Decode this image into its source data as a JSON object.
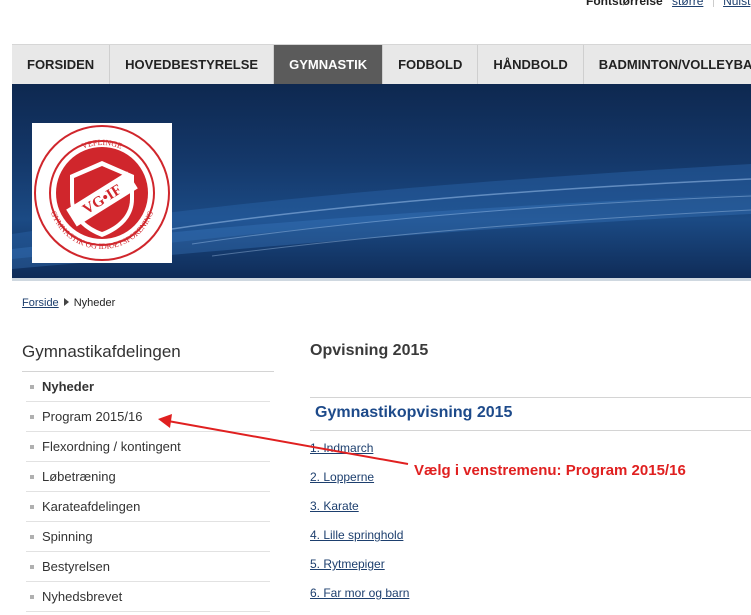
{
  "font_bar": {
    "label": "Fontstørrelse",
    "bigger": "større",
    "reset": "Nulst"
  },
  "nav": [
    {
      "label": "FORSIDEN",
      "active": false
    },
    {
      "label": "HOVEDBESTYRELSE",
      "active": false
    },
    {
      "label": "GYMNASTIK",
      "active": true
    },
    {
      "label": "FODBOLD",
      "active": false
    },
    {
      "label": "HÅNDBOLD",
      "active": false
    },
    {
      "label": "BADMINTON/VOLLEYBALL",
      "active": false
    }
  ],
  "logo": {
    "top_text": "VEFLINGE",
    "shield_text": "VG•IF",
    "bottom_text": "GYMNASTIK OG IDRÆTSFORENING"
  },
  "breadcrumb": {
    "home": "Forside",
    "current": "Nyheder"
  },
  "sidebar": {
    "title": "Gymnastikafdelingen",
    "items": [
      {
        "label": "Nyheder",
        "active": true
      },
      {
        "label": "Program 2015/16",
        "active": false
      },
      {
        "label": "Flexordning / kontingent",
        "active": false
      },
      {
        "label": "Løbetræning",
        "active": false
      },
      {
        "label": "Karateafdelingen",
        "active": false
      },
      {
        "label": "Spinning",
        "active": false
      },
      {
        "label": "Bestyrelsen",
        "active": false
      },
      {
        "label": "Nyhedsbrevet",
        "active": false
      }
    ]
  },
  "main": {
    "title": "Opvisning 2015",
    "section_title": "Gymnastikopvisning 2015",
    "program": [
      "1. Indmarch",
      "2. Lopperne",
      "3. Karate",
      "4. Lille springhold",
      "5. Rytmepiger",
      "6. Far mor og barn"
    ]
  },
  "annotation": {
    "text": "Vælg i venstremenu: Program 2015/16",
    "color": "#e02020"
  },
  "colors": {
    "nav_active": "#5b5b5b",
    "banner": "#14386a",
    "link": "#1d3f6e",
    "section_title": "#1d4a8a",
    "logo_red": "#d0262c"
  }
}
